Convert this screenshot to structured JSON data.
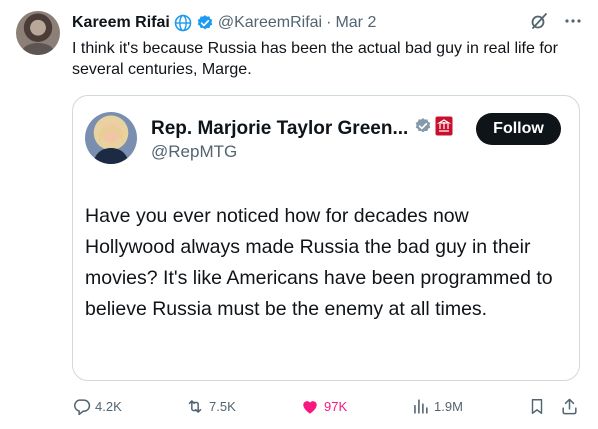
{
  "tweet": {
    "author_name": "Kareem Rifai",
    "author_handle": "@KareemRifai",
    "separator": "·",
    "date": "Mar 2",
    "text": "I think it's because Russia has been the actual bad guy in real life for several centuries, Marge."
  },
  "quote": {
    "author_name": "Rep. Marjorie Taylor Green...",
    "author_handle": "@RepMTG",
    "follow_label": "Follow",
    "text": "Have you ever noticed how for decades now Hollywood always made Russia the bad guy in their movies?  It's like Americans have been programmed to believe Russia must be the enemy at all times."
  },
  "actions": {
    "replies": "4.2K",
    "reposts": "7.5K",
    "likes": "97K",
    "views": "1.9M"
  },
  "icons": {
    "globe": "globe-icon",
    "verified": "verified-badge-icon",
    "grok": "grok-icon",
    "more": "more-icon",
    "reply": "reply-icon",
    "repost": "repost-icon",
    "like": "heart-icon",
    "views": "views-icon",
    "bookmark": "bookmark-icon",
    "share": "share-icon"
  },
  "colors": {
    "verified_blue": "#1d9bf0",
    "like_pink": "#f91880",
    "muted_text": "#536471",
    "follow_bg": "#0f1419"
  }
}
